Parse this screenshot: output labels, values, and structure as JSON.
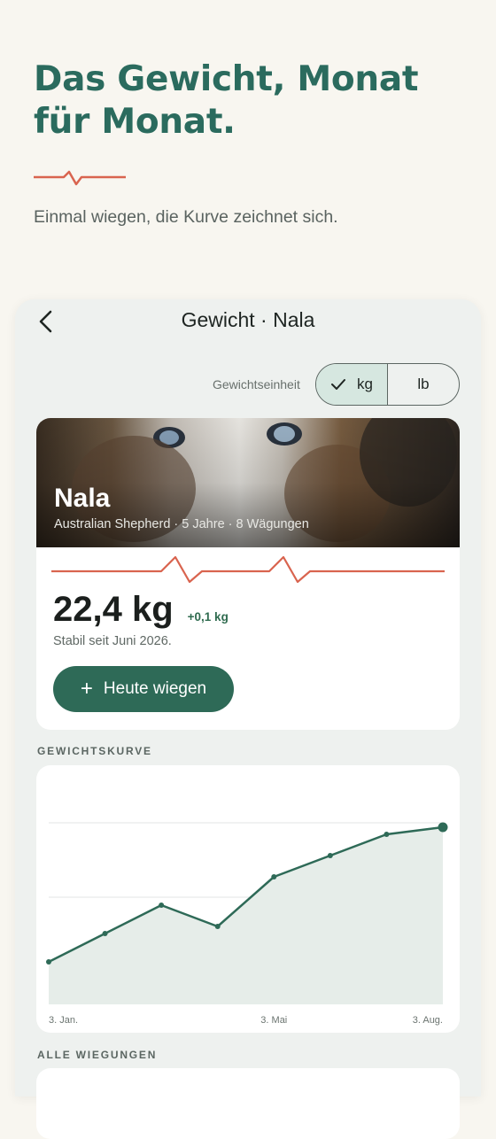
{
  "hero": {
    "title": "Das Gewicht, Monat für Monat.",
    "subtitle": "Einmal wiegen, die Kurve zeichnet sich."
  },
  "nav": {
    "title": "Gewicht · Nala",
    "back_icon": "chevron-left-icon"
  },
  "unit": {
    "label": "Gewichtseinheit",
    "options": [
      "kg",
      "lb"
    ],
    "selected": "kg"
  },
  "pet": {
    "name": "Nala",
    "meta": "Australian Shepherd · 5 Jahre · 8 Wägungen",
    "weight": "22,4 kg",
    "delta": "+0,1 kg",
    "status": "Stabil seit Juni 2026.",
    "weigh_button": "Heute wiegen"
  },
  "sections": {
    "curve": "GEWICHTSKURVE",
    "all": "ALLE WIEGUNGEN"
  },
  "colors": {
    "accent": "#2e6a57",
    "title": "#2b6b5e",
    "pulse": "#d9644f",
    "line": "#2e6a57",
    "fill": "#e6ede9"
  },
  "chart_data": {
    "type": "area",
    "x": [
      "3. Jan.",
      "",
      "",
      "",
      "3. Mai",
      "",
      "",
      "3. Aug."
    ],
    "x_ticks": [
      "3. Jan.",
      "3. Mai",
      "3. Aug."
    ],
    "values": [
      20.2,
      20.6,
      21.0,
      20.7,
      21.4,
      21.7,
      22.0,
      22.1
    ],
    "ylim": [
      19.6,
      22.6
    ],
    "grid": true,
    "last_point_highlight": true
  }
}
